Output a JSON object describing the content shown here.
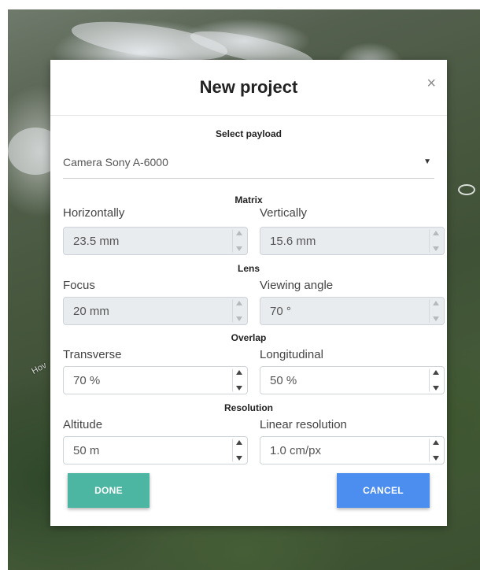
{
  "background": {
    "place_label": "Hov"
  },
  "modal": {
    "title": "New project",
    "close_glyph": "×",
    "payload_heading": "Select payload",
    "payload_value": "Camera Sony A-6000",
    "payload_caret": "▼",
    "sections": {
      "matrix": {
        "heading": "Matrix",
        "left_label": "Horizontally",
        "left_value": "23.5 mm",
        "right_label": "Vertically",
        "right_value": "15.6 mm"
      },
      "lens": {
        "heading": "Lens",
        "left_label": "Focus",
        "left_value": "20 mm",
        "right_label": "Viewing angle",
        "right_value": "70 °"
      },
      "overlap": {
        "heading": "Overlap",
        "left_label": "Transverse",
        "left_value": "70 %",
        "right_label": "Longitudinal",
        "right_value": "50 %"
      },
      "resolution": {
        "heading": "Resolution",
        "left_label": "Altitude",
        "left_value": "50 m",
        "right_label": "Linear resolution",
        "right_value": "1.0 cm/px"
      }
    },
    "buttons": {
      "done_label": "DONE",
      "cancel_label": "CANCEL"
    }
  },
  "colors": {
    "done_button": "#4db6a2",
    "cancel_button": "#4c8ef0",
    "disabled_input": "#e9ecef"
  },
  "icons": {
    "close": "close-icon",
    "caret": "chevron-down-icon",
    "spinner_up": "arrow-up-icon",
    "spinner_down": "arrow-down-icon"
  }
}
